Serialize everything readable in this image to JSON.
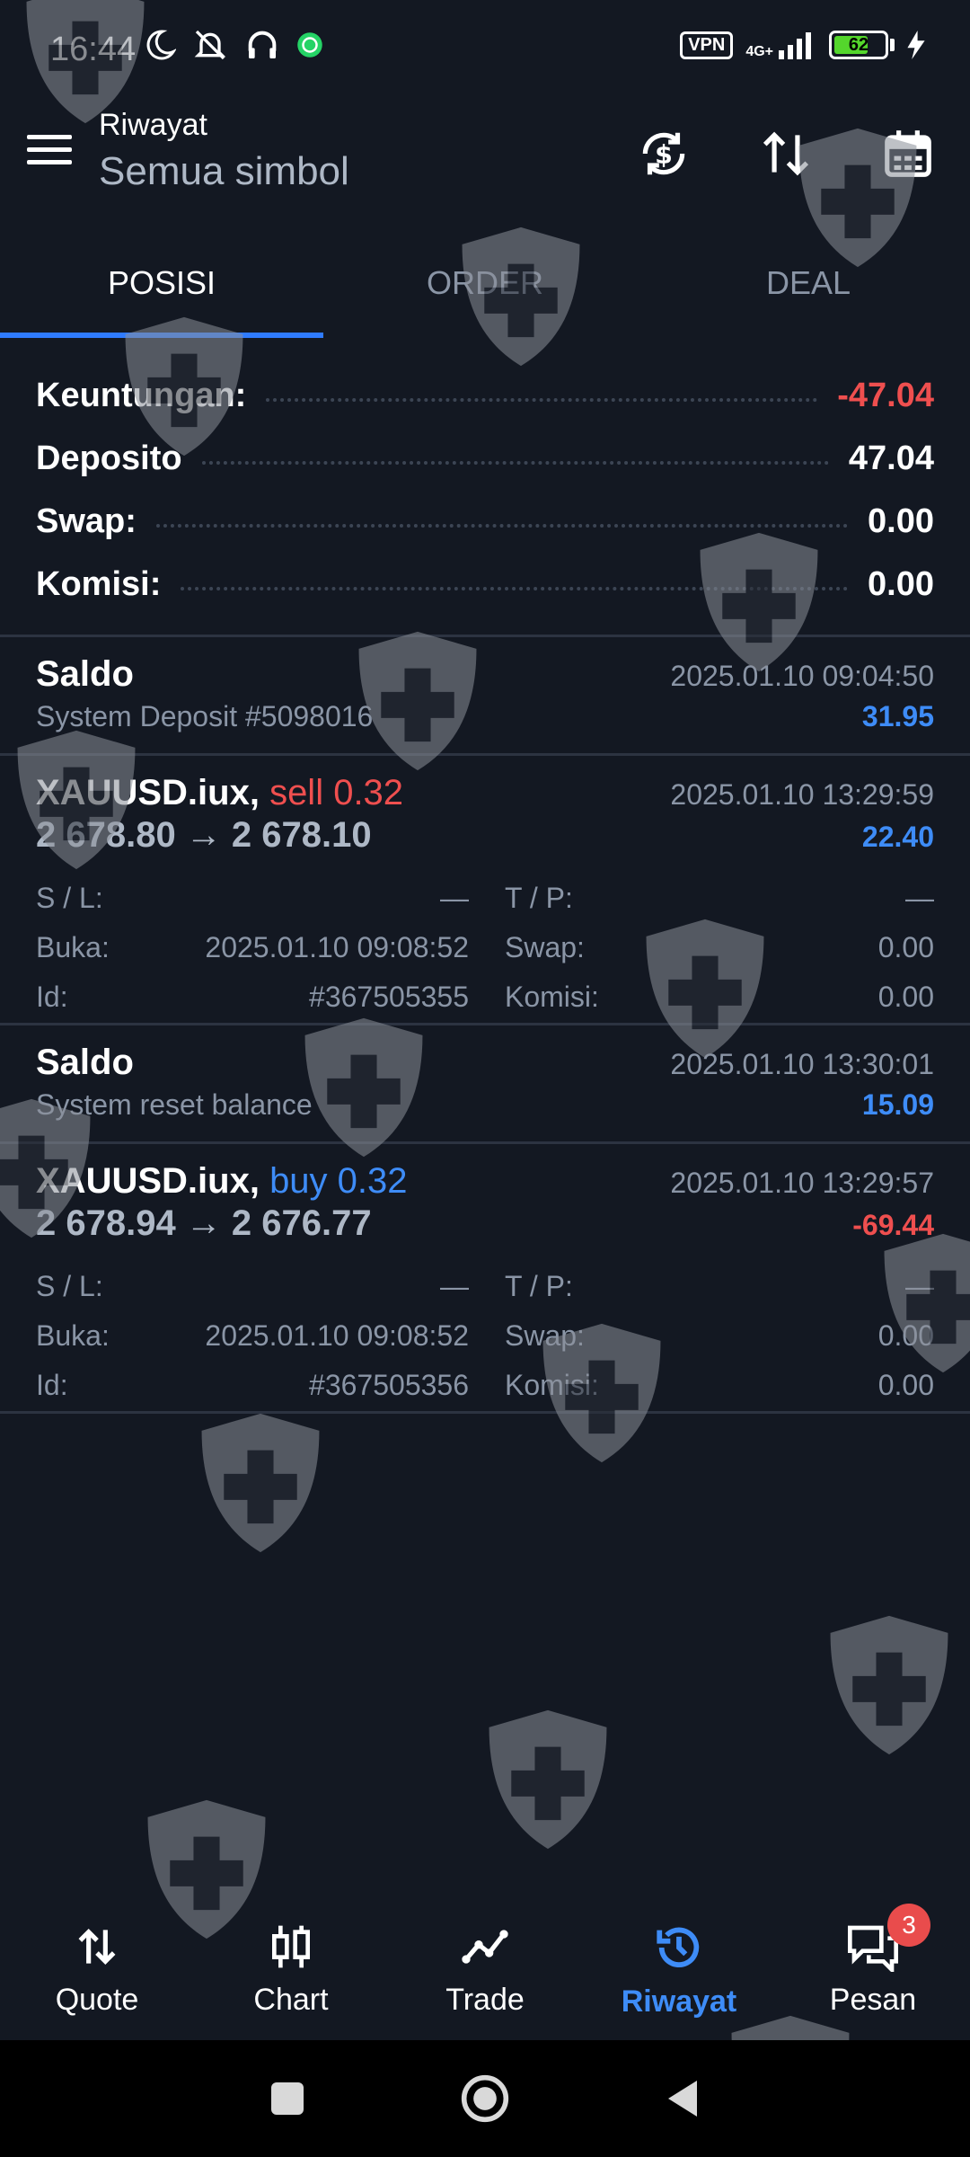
{
  "status_bar": {
    "time": "16:44",
    "vpn_label": "VPN",
    "network_label": "4G+",
    "battery_level": "62",
    "icons": [
      "moon-icon",
      "bell-muted-icon",
      "headphones-icon",
      "whatsapp-icon",
      "signal-icon",
      "charging-icon"
    ]
  },
  "header": {
    "title": "Riwayat",
    "subtitle": "Semua simbol",
    "actions": [
      "currency-exchange-icon",
      "sort-icon",
      "calendar-icon"
    ]
  },
  "tabs": [
    {
      "label": "POSISI",
      "active": true
    },
    {
      "label": "ORDER",
      "active": false
    },
    {
      "label": "DEAL",
      "active": false
    }
  ],
  "summary": [
    {
      "label": "Keuntungan:",
      "value": "-47.04",
      "tone": "neg"
    },
    {
      "label": "Deposito",
      "value": "47.04",
      "tone": ""
    },
    {
      "label": "Swap:",
      "value": "0.00",
      "tone": ""
    },
    {
      "label": "Komisi:",
      "value": "0.00",
      "tone": ""
    }
  ],
  "entries": {
    "balance1": {
      "title": "Saldo",
      "date": "2025.01.10 09:04:50",
      "desc": "System Deposit #5098016",
      "amount": "31.95"
    },
    "trade1": {
      "symbol": "XAUUSD.iux,",
      "side": "sell 0.32",
      "date": "2025.01.10 13:29:59",
      "prices": "2 678.80 → 2 678.10",
      "amount": "22.40",
      "sl_label": "S / L:",
      "sl_value": "—",
      "tp_label": "T / P:",
      "tp_value": "—",
      "open_label": "Buka:",
      "open_value": "2025.01.10 09:08:52",
      "swap_label": "Swap:",
      "swap_value": "0.00",
      "id_label": "Id:",
      "id_value": "#367505355",
      "commission_label": "Komisi:",
      "commission_value": "0.00"
    },
    "balance2": {
      "title": "Saldo",
      "date": "2025.01.10 13:30:01",
      "desc": "System reset balance",
      "amount": "15.09"
    },
    "trade2": {
      "symbol": "XAUUSD.iux,",
      "side": "buy 0.32",
      "date": "2025.01.10 13:29:57",
      "prices": "2 678.94 → 2 676.77",
      "amount": "-69.44",
      "sl_label": "S / L:",
      "sl_value": "—",
      "tp_label": "T / P:",
      "tp_value": "—",
      "open_label": "Buka:",
      "open_value": "2025.01.10 09:08:52",
      "swap_label": "Swap:",
      "swap_value": "0.00",
      "id_label": "Id:",
      "id_value": "#367505356",
      "commission_label": "Komisi:",
      "commission_value": "0.00"
    }
  },
  "bottom_nav": [
    {
      "label": "Quote",
      "icon": "quote-arrows-icon",
      "active": false
    },
    {
      "label": "Chart",
      "icon": "candlestick-chart-icon",
      "active": false
    },
    {
      "label": "Trade",
      "icon": "trade-line-icon",
      "active": false
    },
    {
      "label": "Riwayat",
      "icon": "history-icon",
      "active": true
    },
    {
      "label": "Pesan",
      "icon": "messages-icon",
      "active": false,
      "badge": "3"
    }
  ],
  "colors": {
    "background": "#131822",
    "accent": "#2f7bff",
    "positive": "#3e8cf7",
    "negative": "#ef4f4f",
    "muted": "#8a95a6"
  }
}
